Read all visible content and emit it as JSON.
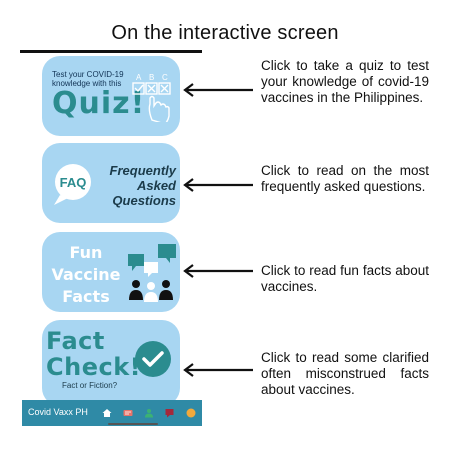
{
  "header": {
    "title": "On the interactive screen"
  },
  "cards": {
    "quiz": {
      "small_text": [
        "Test your COVID-19",
        "knowledge with this"
      ],
      "big_text": "Quiz!",
      "abc": [
        "A",
        "B",
        "C"
      ]
    },
    "faq": {
      "bubble_text": "FAQ",
      "lines": [
        "Frequently",
        "Asked",
        "Questions"
      ]
    },
    "fun": {
      "lines": [
        "Fun",
        "Vaccine",
        "Facts"
      ]
    },
    "fact": {
      "lines": [
        "Fact",
        "Check!"
      ],
      "sub": "Fact or Fiction?"
    }
  },
  "descriptions": [
    "Click to take a quiz to test your knowledge of covid-19 vaccines in the Philippines.",
    "Click to read on the most frequently asked questions.",
    "Click to read fun facts about vaccines.",
    "Click to read some clarified often misconstrued facts about vaccines."
  ],
  "bottom_bar": {
    "title": "Covid Vaxx PH",
    "icons": [
      {
        "name": "home-icon",
        "color": "#ffffff"
      },
      {
        "name": "quiz-icon",
        "color": "#e8746a"
      },
      {
        "name": "person-icon",
        "color": "#3bb273"
      },
      {
        "name": "chat-icon",
        "color": "#a5283a"
      },
      {
        "name": "check-icon",
        "color": "#f2a93b"
      }
    ]
  },
  "colors": {
    "card_bg": "#a8d6f2",
    "teal": "#2b8c8f",
    "bar_bg": "#2f8aa6"
  }
}
